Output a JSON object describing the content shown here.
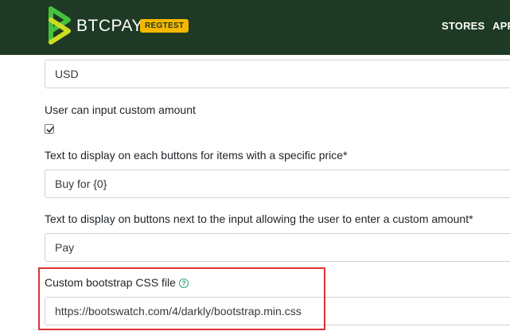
{
  "header": {
    "brand": "BTCPAY",
    "badge": "REGTEST",
    "nav": [
      "STORES",
      "APPS"
    ]
  },
  "form": {
    "currency_value": "USD",
    "custom_amount_label": "User can input custom amount",
    "custom_amount_checked": true,
    "button_text_label": "Text to display on each buttons for items with a specific price*",
    "button_text_value": "Buy for {0}",
    "custom_button_text_label": "Text to display on buttons next to the input allowing the user to enter a custom amount*",
    "custom_button_text_value": "Pay",
    "css_label": "Custom bootstrap CSS file",
    "css_help_icon": "question-circle-icon",
    "css_value": "https://bootswatch.com/4/darkly/bootstrap.min.css"
  },
  "colors": {
    "navbar": "#1e3a24",
    "brand_green": "#44c23c",
    "badge": "#f5b800",
    "help": "#329f80",
    "highlight": "#e03131"
  }
}
